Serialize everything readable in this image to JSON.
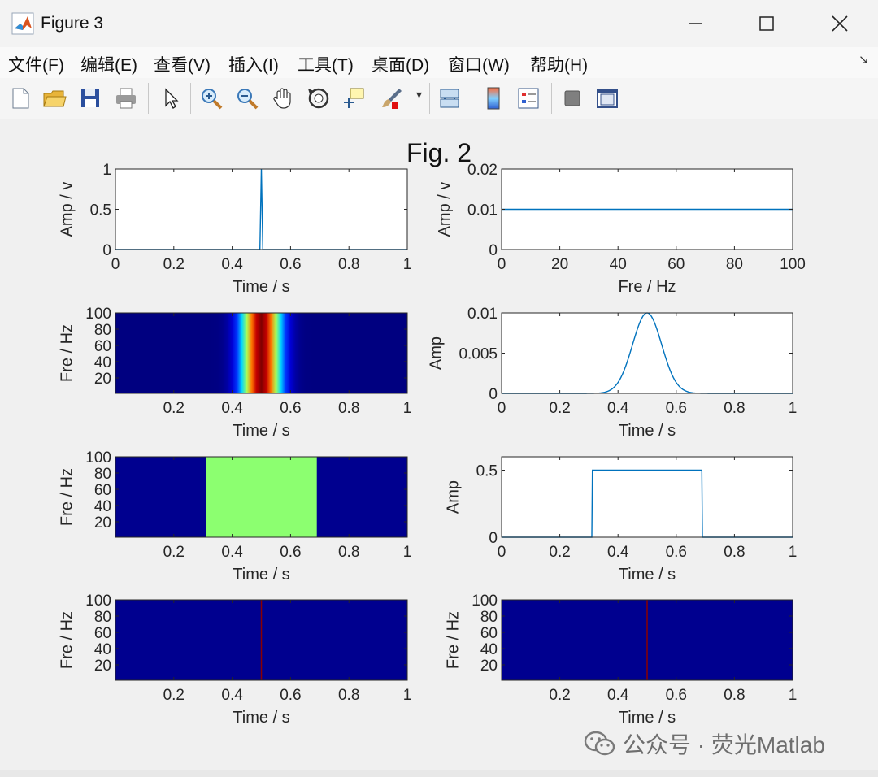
{
  "window": {
    "title": "Figure 3",
    "minimize_glyph": "—",
    "close_glyph": "✕",
    "app_icon": "matlab-icon"
  },
  "menu": {
    "items": [
      {
        "label": "文件(F)"
      },
      {
        "label": "编辑(E)"
      },
      {
        "label": "查看(V)"
      },
      {
        "label": "插入(I)"
      },
      {
        "label": "工具(T)"
      },
      {
        "label": "桌面(D)"
      },
      {
        "label": "窗口(W)"
      },
      {
        "label": "帮助(H)"
      }
    ],
    "expand_glyph": "↘"
  },
  "toolbar": {
    "tools": [
      {
        "name": "new-figure-icon"
      },
      {
        "name": "open-file-icon"
      },
      {
        "name": "save-icon"
      },
      {
        "name": "print-icon"
      },
      {
        "name": "edit-pointer-icon"
      },
      {
        "name": "zoom-in-icon"
      },
      {
        "name": "zoom-out-icon"
      },
      {
        "name": "pan-hand-icon"
      },
      {
        "name": "rotate-3d-icon"
      },
      {
        "name": "data-cursor-icon"
      },
      {
        "name": "brush-icon"
      },
      {
        "name": "link-plot-icon"
      },
      {
        "name": "colorbar-icon"
      },
      {
        "name": "legend-icon"
      },
      {
        "name": "hide-plot-tools-icon"
      },
      {
        "name": "show-plot-tools-icon"
      }
    ],
    "dropdown_glyph": "▾"
  },
  "figure": {
    "title": "Fig. 2"
  },
  "watermark": {
    "text": "公众号 · 荧光Matlab",
    "icon": "wechat-icon"
  },
  "colors": {
    "line": "#0072bd",
    "jet_low": "#00008f",
    "rect_fill": "#8cff70",
    "axes_bg": "#ffffff"
  },
  "chart_data": [
    {
      "type": "line",
      "name": "impulse-signal",
      "x": [
        0,
        0.495,
        0.5,
        0.505,
        1
      ],
      "y": [
        0,
        0,
        1,
        0,
        0
      ],
      "xlim": [
        0,
        1
      ],
      "ylim": [
        0,
        1
      ],
      "xticks": [
        "0",
        "0.2",
        "0.4",
        "0.6",
        "0.8",
        "1"
      ],
      "yticks": [
        "0",
        "0.5",
        "1"
      ],
      "xlabel": "Time / s",
      "ylabel": "Amp / v"
    },
    {
      "type": "line",
      "name": "flat-spectrum",
      "x": [
        0,
        100
      ],
      "y": [
        0.01,
        0.01
      ],
      "xlim": [
        0,
        100
      ],
      "ylim": [
        0,
        0.02
      ],
      "xticks": [
        "0",
        "20",
        "40",
        "60",
        "80",
        "100"
      ],
      "yticks": [
        "0",
        "0.01",
        "0.02"
      ],
      "xlabel": "Fre / Hz",
      "ylabel": "Amp / v"
    },
    {
      "type": "heatmap",
      "name": "tf-gaussian-band",
      "pattern": "gaussian-band",
      "center": 0.5,
      "sigma": 0.045,
      "xlim": [
        0,
        1
      ],
      "ylim": [
        1,
        100
      ],
      "xticks": [
        "0.2",
        "0.4",
        "0.6",
        "0.8",
        "1"
      ],
      "yticks": [
        "20",
        "40",
        "60",
        "80",
        "100"
      ],
      "xlabel": "Time / s",
      "ylabel": "Fre / Hz"
    },
    {
      "type": "line",
      "name": "gaussian-window",
      "curve": "gaussian",
      "center": 0.5,
      "sigma": 0.05,
      "peak": 0.01,
      "xlim": [
        0,
        1
      ],
      "ylim": [
        0,
        0.01
      ],
      "xticks": [
        "0",
        "0.2",
        "0.4",
        "0.6",
        "0.8",
        "1"
      ],
      "yticks": [
        "0",
        "0.005",
        "0.01"
      ],
      "xlabel": "Time / s",
      "ylabel": "Amp"
    },
    {
      "type": "heatmap",
      "name": "tf-rect-band",
      "pattern": "rect-band",
      "start": 0.31,
      "end": 0.69,
      "xlim": [
        0,
        1
      ],
      "ylim": [
        1,
        100
      ],
      "xticks": [
        "0.2",
        "0.4",
        "0.6",
        "0.8",
        "1"
      ],
      "yticks": [
        "20",
        "40",
        "60",
        "80",
        "100"
      ],
      "xlabel": "Time / s",
      "ylabel": "Fre / Hz"
    },
    {
      "type": "line",
      "name": "rect-window",
      "x": [
        0,
        0.31,
        0.312,
        0.688,
        0.69,
        1
      ],
      "y": [
        0,
        0,
        0.5,
        0.5,
        0,
        0
      ],
      "xlim": [
        0,
        1
      ],
      "ylim": [
        0,
        0.6
      ],
      "xticks": [
        "0",
        "0.2",
        "0.4",
        "0.6",
        "0.8",
        "1"
      ],
      "yticks": [
        "0",
        "0.5"
      ],
      "xlabel": "Time / s",
      "ylabel": "Amp"
    },
    {
      "type": "heatmap",
      "name": "tf-impulse-line-a",
      "pattern": "line",
      "at": 0.5,
      "xlim": [
        0,
        1
      ],
      "ylim": [
        1,
        100
      ],
      "xticks": [
        "0.2",
        "0.4",
        "0.6",
        "0.8",
        "1"
      ],
      "yticks": [
        "20",
        "40",
        "60",
        "80",
        "100"
      ],
      "xlabel": "Time / s",
      "ylabel": "Fre / Hz"
    },
    {
      "type": "heatmap",
      "name": "tf-impulse-line-b",
      "pattern": "line",
      "at": 0.5,
      "xlim": [
        0,
        1
      ],
      "ylim": [
        1,
        100
      ],
      "xticks": [
        "0.2",
        "0.4",
        "0.6",
        "0.8",
        "1"
      ],
      "yticks": [
        "20",
        "40",
        "60",
        "80",
        "100"
      ],
      "xlabel": "Time / s",
      "ylabel": "Fre / Hz"
    }
  ]
}
